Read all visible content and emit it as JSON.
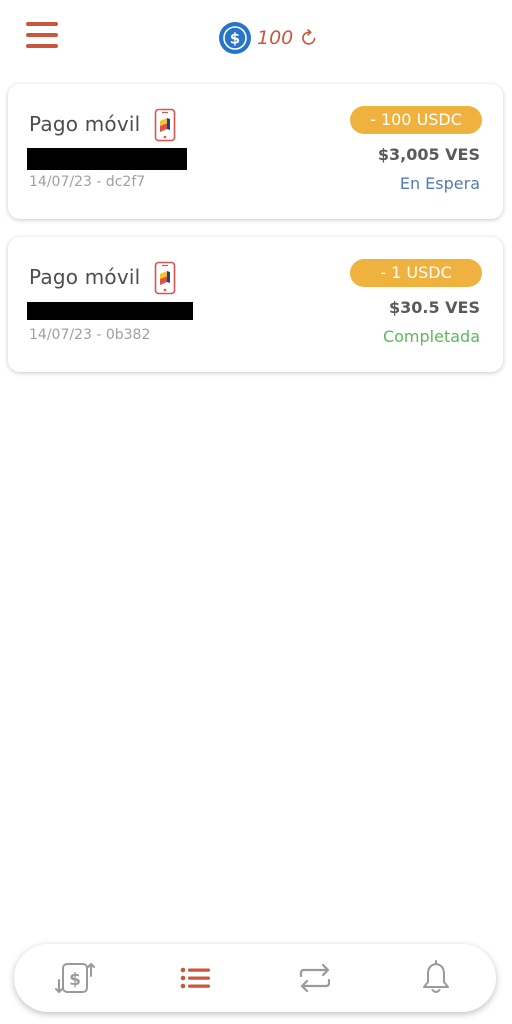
{
  "header": {
    "balance": "100",
    "icons": {
      "menu": "hamburger-menu-icon",
      "currency": "usdc-icon",
      "refresh": "refresh-icon"
    }
  },
  "transactions": [
    {
      "method": "Pago móvil",
      "amount": "- 100 USDC",
      "ves_amount": "$3,005 VES",
      "date_id": "14/07/23 - dc2f7",
      "status": "En Espera",
      "status_color": "#4f7bb8",
      "icon": "mobile-payment-icon"
    },
    {
      "method": "Pago móvil",
      "amount": "- 1 USDC",
      "ves_amount": "$30.5 VES",
      "date_id": "14/07/23 - 0b382",
      "status": "Completada",
      "status_color": "#5cb85c",
      "icon": "mobile-payment-icon"
    }
  ],
  "bottom_nav": {
    "items": [
      {
        "icon": "exchange-dollar-icon",
        "active": false
      },
      {
        "icon": "list-icon",
        "active": true
      },
      {
        "icon": "swap-icon",
        "active": false
      },
      {
        "icon": "bell-icon",
        "active": false
      }
    ]
  },
  "colors": {
    "accent": "#c8573b",
    "pill": "#f0b23f",
    "usdc_blue": "#2775ca",
    "inactive_icon": "#9a9a9a"
  }
}
